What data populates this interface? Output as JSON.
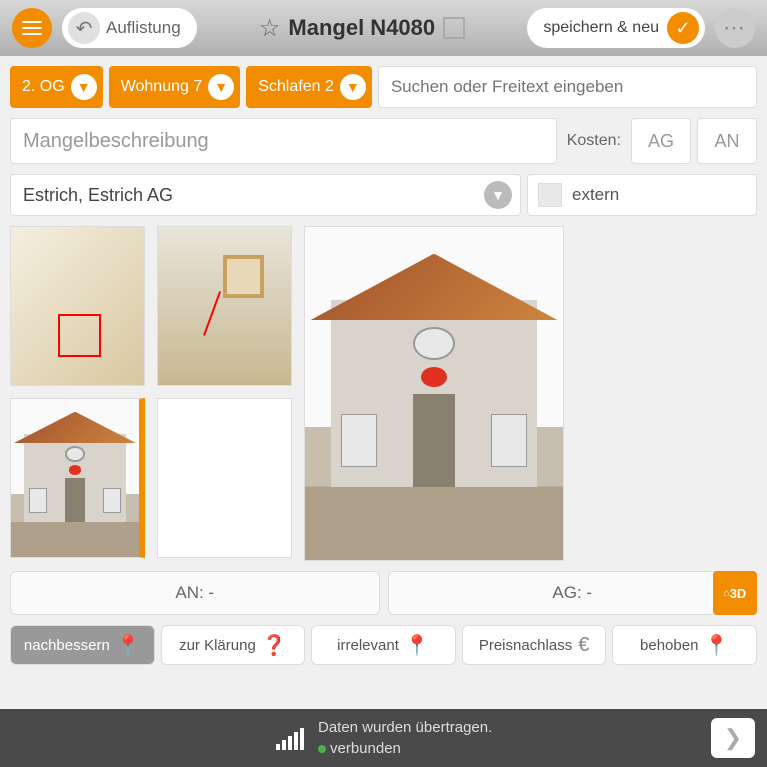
{
  "header": {
    "back_label": "Auflistung",
    "title": "Mangel N4080",
    "save_label": "speichern & neu"
  },
  "breadcrumbs": [
    "2. OG",
    "Wohnung 7",
    "Schlafen 2"
  ],
  "search": {
    "placeholder": "Suchen oder Freitext eingeben"
  },
  "description": {
    "placeholder": "Mangelbeschreibung"
  },
  "costs": {
    "label": "Kosten:",
    "ag": "AG",
    "an": "AN"
  },
  "contractor": {
    "value": "Estrich, Estrich AG",
    "extern_label": "extern"
  },
  "an_ag": {
    "an": "AN: -",
    "ag": "AG: -",
    "btn3d": "3D"
  },
  "status": [
    "nachbessern",
    "zur Klärung",
    "irrelevant",
    "Preisnachlass",
    "behoben"
  ],
  "footer": {
    "line1": "Daten wurden übertragen.",
    "line2": "verbunden"
  }
}
